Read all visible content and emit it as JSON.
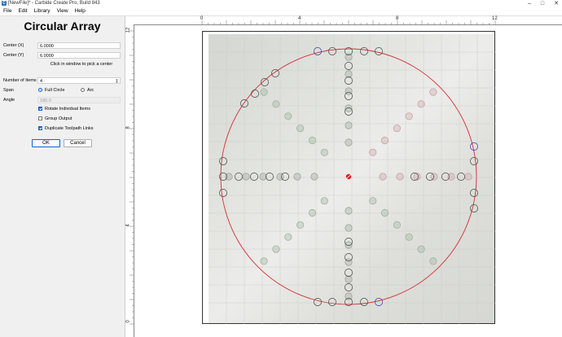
{
  "window": {
    "app_icon": "carbide-create-icon",
    "title": "[NewFile]* - Carbide Create Pro, Build 843",
    "controls": [
      "minimize-icon",
      "maximize-icon",
      "close-icon"
    ],
    "control_glyphs": [
      "–",
      "□",
      "✕"
    ]
  },
  "menu": [
    {
      "label": "File",
      "name": "menu-file"
    },
    {
      "label": "Edit",
      "name": "menu-edit"
    },
    {
      "label": "Library",
      "name": "menu-library"
    },
    {
      "label": "View",
      "name": "menu-view"
    },
    {
      "label": "Help",
      "name": "menu-help"
    }
  ],
  "panel": {
    "title": "Circular Array",
    "center_x_label": "Center (X)",
    "center_x_value": "6.0000",
    "center_y_label": "Center (Y)",
    "center_y_value": "6.0000",
    "hint": "Click in window to pick a center",
    "items_label": "Number of Items",
    "items_value": "4",
    "span_label": "Span",
    "span_full": "Full Circle",
    "span_arc": "Arc",
    "span_selected": "Full Circle",
    "angle_label": "Angle",
    "angle_value": "180.0",
    "rotate_label": "Rotate Individual Items",
    "rotate_checked": true,
    "group_label": "Group Output",
    "group_checked": false,
    "duplicate_label": "Duplicate Toolpath Links",
    "duplicate_checked": true,
    "ok_label": "OK",
    "cancel_label": "Cancel"
  },
  "ruler": {
    "top_labels": [
      "0",
      "4",
      "8",
      "12"
    ],
    "left_labels": [
      "12",
      "8",
      "4",
      "0"
    ]
  },
  "colors": {
    "circle": "#d0313a",
    "selected_hole": "#3a35a8",
    "hole": "#444444",
    "center_marker": "#e01b24"
  }
}
